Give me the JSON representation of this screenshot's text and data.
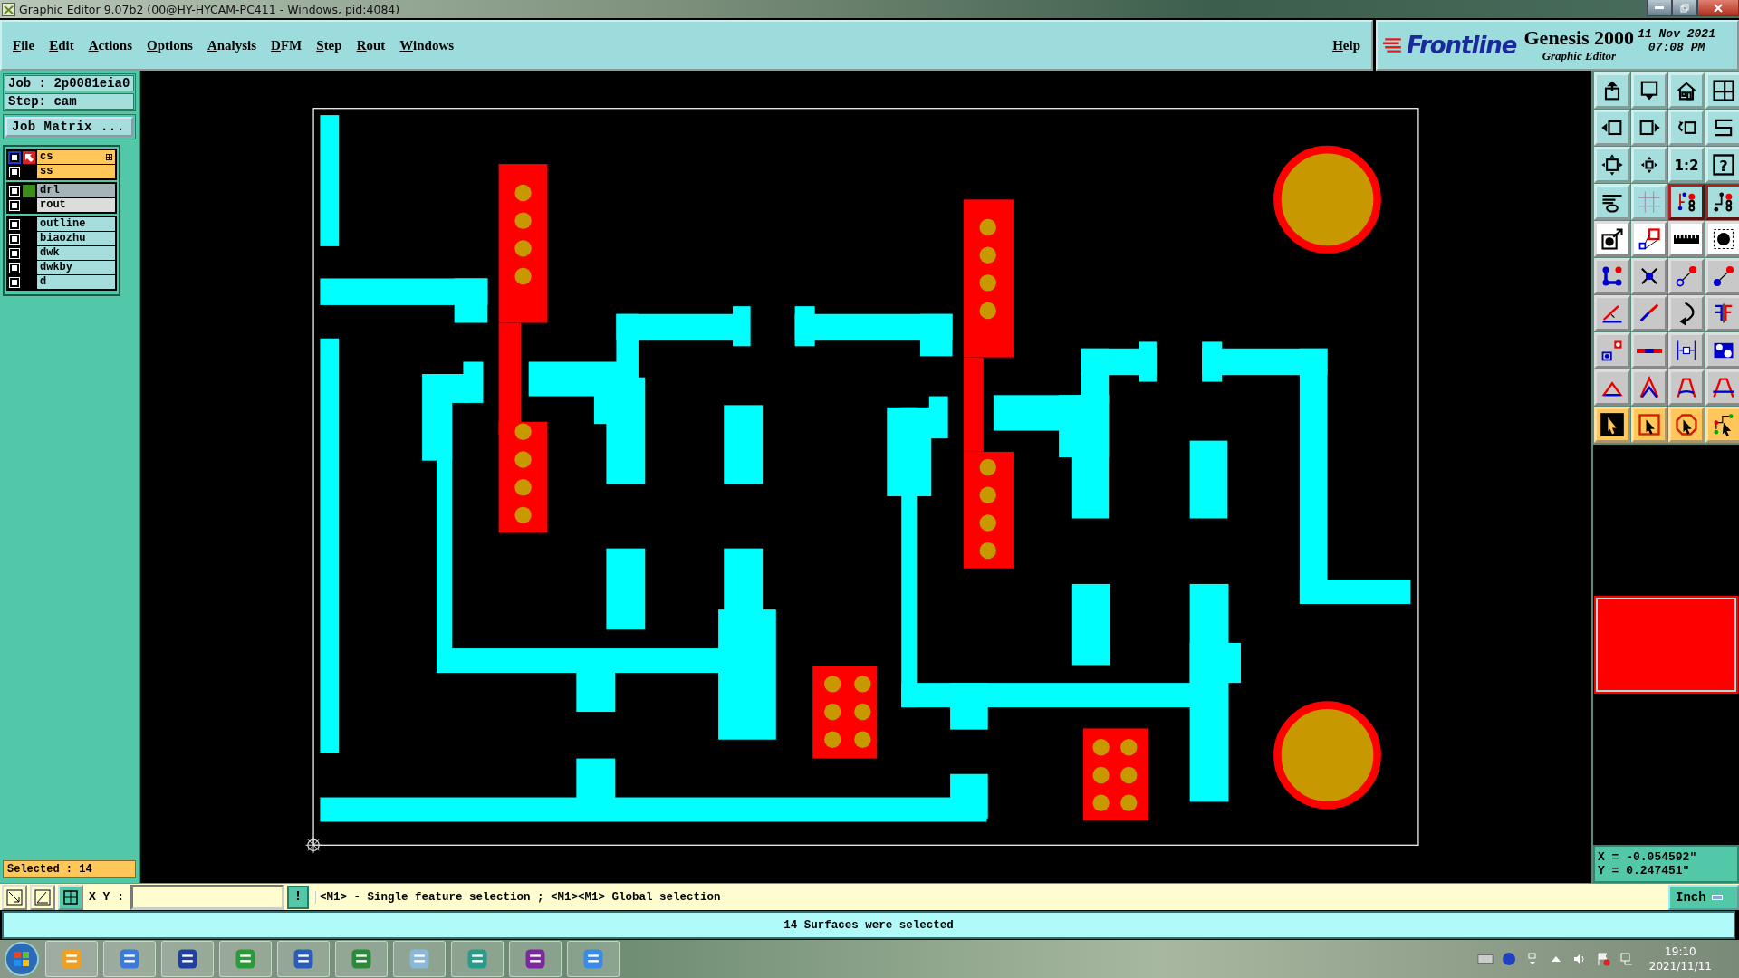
{
  "window": {
    "title": "Graphic Editor 9.07b2 (00@HY-HYCAM-PC411 - Windows, pid:4084)"
  },
  "menu": [
    {
      "label": "File"
    },
    {
      "label": "Edit"
    },
    {
      "label": "Actions"
    },
    {
      "label": "Options"
    },
    {
      "label": "Analysis"
    },
    {
      "label": "DFM"
    },
    {
      "label": "Step"
    },
    {
      "label": "Rout"
    },
    {
      "label": "Windows"
    }
  ],
  "help": "Help",
  "brand": {
    "logo": "Frontline",
    "product": "Genesis 2000",
    "subtitle": "Graphic Editor",
    "date": "11 Nov 2021",
    "time": "07:08 PM"
  },
  "job_panel": {
    "job": "Job : 2p0081eia0",
    "step": "Step: cam",
    "matrix_button": "Job Matrix ...",
    "layer_groups": [
      {
        "layers": [
          {
            "name": "cs",
            "color": "#ffc65a",
            "checked": false,
            "work_layer": true
          },
          {
            "name": "ss",
            "color": "#ffc65a",
            "checked": false,
            "work_layer": false
          }
        ]
      },
      {
        "layers": [
          {
            "name": "drl",
            "color": "#a4b4b8",
            "checked": false,
            "work_layer": false,
            "swatch": {
              "color": "#3c8c1c"
            }
          },
          {
            "name": "rout",
            "color": "#dcdcdc",
            "checked": false,
            "work_layer": false
          }
        ]
      },
      {
        "layers": [
          {
            "name": "outline",
            "color": "#a6dede",
            "checked": false,
            "work_layer": false
          },
          {
            "name": "biaozhu",
            "color": "#a6dede",
            "checked": false,
            "work_layer": false
          },
          {
            "name": "dwk",
            "color": "#a6dede",
            "checked": false,
            "work_layer": false
          },
          {
            "name": "dwkby",
            "color": "#a6dede",
            "checked": false,
            "work_layer": false
          },
          {
            "name": "d",
            "color": "#a6dede",
            "checked": false,
            "work_layer": false
          }
        ]
      }
    ],
    "selected_count": "Selected : 14"
  },
  "toolbar": {
    "scale_label": "1:2",
    "help_label": "?"
  },
  "coordinates": {
    "x": "X = -0.054592\"",
    "y": "Y = 0.247451\""
  },
  "command_bar": {
    "label": "X Y :",
    "alert_label": "!",
    "prompt": "<M1> - Single feature selection ; <M1><M1> Global selection",
    "units": "Inch"
  },
  "status_bar": "14 Surfaces were selected",
  "taskbar": {
    "time": "19:10",
    "date": "2021/11/11"
  }
}
